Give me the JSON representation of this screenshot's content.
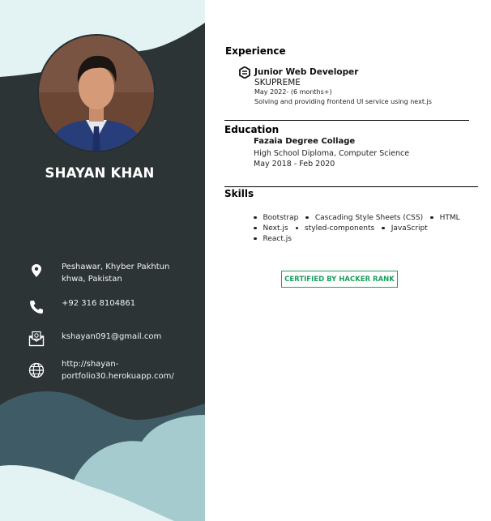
{
  "profile": {
    "name": "SHAYAN KHAN"
  },
  "contacts": [
    {
      "icon": "location-icon",
      "text_lines": [
        "Peshawar, Khyber Pakhtun",
        "khwa, Pakistan"
      ]
    },
    {
      "icon": "phone-icon",
      "text_lines": [
        "+92 316 8104861"
      ]
    },
    {
      "icon": "email-icon",
      "text_lines": [
        "kshayan091@gmail.com"
      ]
    },
    {
      "icon": "globe-icon",
      "text_lines": [
        "http://shayan-",
        "portfolio30.herokuapp.com/"
      ]
    }
  ],
  "experience": {
    "heading": "Experience",
    "job_title": "Junior Web Developer",
    "company": "SKUPREME",
    "period": "May 2022- (6 months+)",
    "description": "Solving and providing frontend UI service using next.js"
  },
  "education": {
    "heading": "Education",
    "school": "Fazaia Degree Collage",
    "degree": "High School Diploma, Computer Science",
    "period": "May 2018 - Feb 2020"
  },
  "skills": {
    "heading": "Skills",
    "rows": [
      [
        "Bootstrap",
        "Cascading Style Sheets (CSS)",
        "HTML"
      ],
      [
        "Next.js",
        "styled-components",
        "JavaScript"
      ],
      [
        "React.js"
      ]
    ]
  },
  "certification": {
    "label": "CERTIFIED BY HACKER RANK"
  },
  "colors": {
    "sidebar": "#2d3436",
    "blob_light": "#e3f2f2",
    "blob_mid": "#a6cbce",
    "blob_dark": "#3f5c66",
    "accent_green": "#1aa05c"
  }
}
